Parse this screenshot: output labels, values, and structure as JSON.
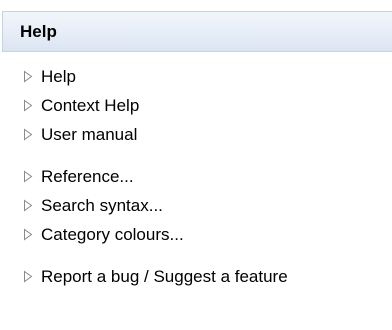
{
  "panel": {
    "title": "Help"
  },
  "groups": [
    {
      "items": [
        {
          "label": "Help",
          "icon": "triangle-right-icon"
        },
        {
          "label": "Context Help",
          "icon": "triangle-right-icon"
        },
        {
          "label": "User manual",
          "icon": "triangle-right-icon"
        }
      ]
    },
    {
      "items": [
        {
          "label": "Reference...",
          "icon": "triangle-right-icon"
        },
        {
          "label": "Search syntax...",
          "icon": "triangle-right-icon"
        },
        {
          "label": "Category colours...",
          "icon": "triangle-right-icon"
        }
      ]
    },
    {
      "items": [
        {
          "label": "Report a bug / Suggest a feature",
          "icon": "triangle-right-icon"
        }
      ]
    }
  ],
  "colors": {
    "header_border": "#c7d3e3",
    "header_background": "#e6edf7",
    "arrow_stroke": "#8a8a8a",
    "text": "#000000"
  }
}
